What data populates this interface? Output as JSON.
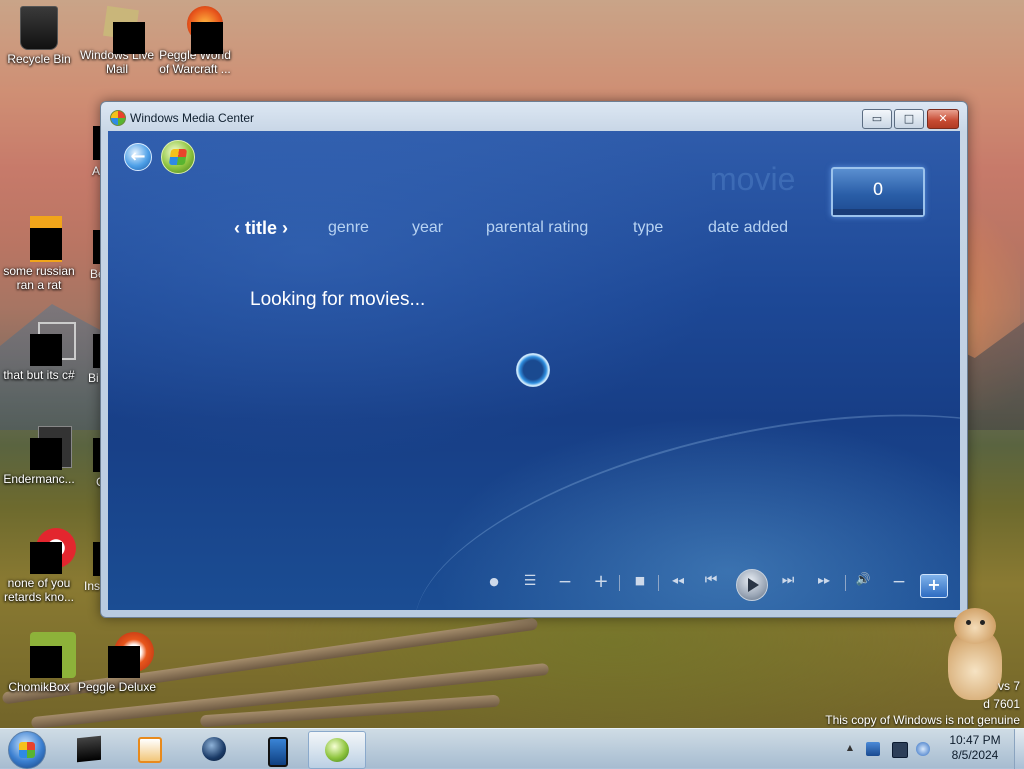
{
  "desktop": {
    "icons": [
      {
        "label": "Recycle Bin"
      },
      {
        "label": "Windows Live Mail"
      },
      {
        "label": "Peggle World of Warcraft ..."
      },
      {
        "label": "some russian ran a rat"
      },
      {
        "label": "that but its c#"
      },
      {
        "label": "Endermanc..."
      },
      {
        "label": "none of you retards kno..."
      },
      {
        "label": "ChomikBox"
      },
      {
        "label": "Peggle Deluxe"
      }
    ],
    "partial_labels": [
      "A",
      "Be",
      "Bi",
      "C",
      "Ins"
    ],
    "watermark": {
      "line1": "vs 7",
      "line2": "d 7601",
      "line3": "This copy of Windows is not genuine"
    }
  },
  "window": {
    "title": "Windows Media Center",
    "buttons": {
      "minimize": "▭",
      "maximize": "□",
      "close": "✕"
    }
  },
  "media_center": {
    "back_icon": "back-arrow-icon",
    "ghost_heading": "movie",
    "item_count": "0",
    "filters": [
      {
        "label": "title",
        "active": true
      },
      {
        "label": "genre"
      },
      {
        "label": "year"
      },
      {
        "label": "parental rating"
      },
      {
        "label": "type"
      },
      {
        "label": "date added"
      }
    ],
    "chevron_left": "‹",
    "chevron_right": "›",
    "status": "Looking for movies...",
    "transport": {
      "record": "●",
      "guide": "☰",
      "ch_minus": "−",
      "ch_plus": "+",
      "stop": "■",
      "rewind": "◂◂",
      "skip_back": "⏮",
      "skip_forward": "⏭",
      "fast_forward": "▸▸",
      "volume": "🔊",
      "vol_minus": "−",
      "zoom_plus": "+"
    }
  },
  "taskbar": {
    "time": "10:47 PM",
    "date": "8/5/2024",
    "tray_expand": "▲"
  },
  "colors": {
    "wmc_blue": "#1d4896",
    "accent_text": "#b8d3f2"
  }
}
